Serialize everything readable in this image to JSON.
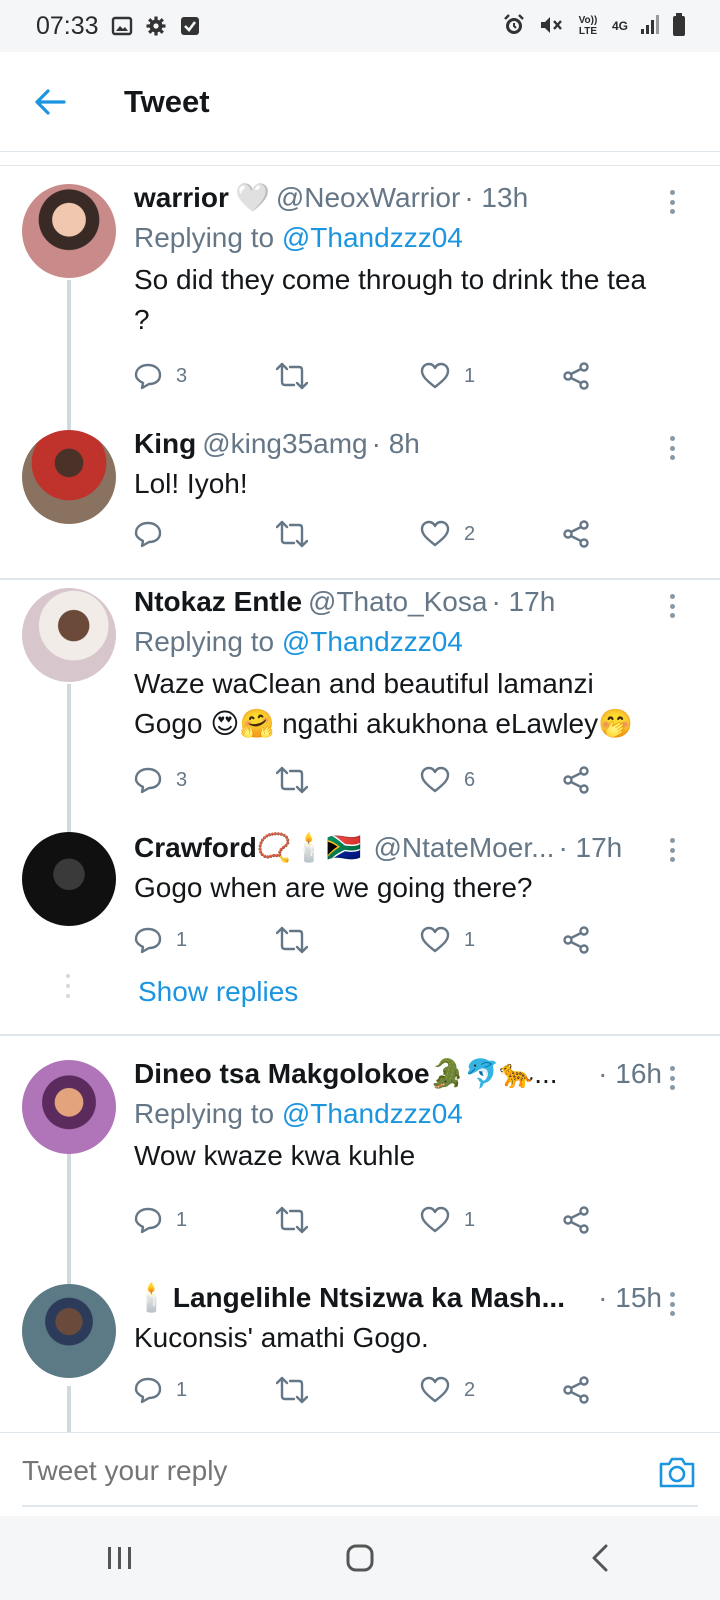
{
  "status_bar": {
    "time": "07:33",
    "network_lte": "Vo)) LTE",
    "network_gen": "4G"
  },
  "header": {
    "title": "Tweet"
  },
  "tweets": [
    {
      "name": "warrior",
      "emoji": "🤍",
      "handle": "@NeoxWarrior",
      "time": "· 13h",
      "replying_prefix": "Replying to ",
      "replying_to": "@Thandzzz04",
      "text": "So did they come through to drink the tea ?",
      "replies": "3",
      "retweets": "",
      "likes": "1",
      "avatar_color": "#c98a8a"
    },
    {
      "name": "King",
      "emoji": "",
      "handle": "@king35amg",
      "time": "· 8h",
      "replying_prefix": "",
      "replying_to": "",
      "text": "Lol!  Iyoh!",
      "replies": "",
      "retweets": "",
      "likes": "2",
      "avatar_color": "#7a5a48"
    },
    {
      "name": "Ntokaz Entle",
      "emoji": "",
      "handle": "@Thato_Kosa",
      "time": "· 17h",
      "replying_prefix": "Replying to ",
      "replying_to": "@Thandzzz04",
      "text": "Waze waClean and beautiful lamanzi Gogo 😍🤗 ngathi akukhona eLawley🤭",
      "replies": "3",
      "retweets": "",
      "likes": "6",
      "avatar_color": "#d7c6cc"
    },
    {
      "name": "Crawford",
      "emoji": "📿🕯️🇿🇦",
      "handle": "@NtateMoer...",
      "time": "· 17h",
      "replying_prefix": "",
      "replying_to": "",
      "text": "Gogo when are we going there?",
      "replies": "1",
      "retweets": "",
      "likes": "1",
      "avatar_color": "#101010"
    },
    {
      "name": "Dineo tsa Makgolokoe",
      "emoji": "🐊🐬🐆...",
      "handle": "",
      "time": "· 16h",
      "replying_prefix": "Replying to ",
      "replying_to": "@Thandzzz04",
      "text": "Wow kwaze kwa kuhle",
      "replies": "1",
      "retweets": "",
      "likes": "1",
      "avatar_color": "#b074b8"
    },
    {
      "name": "Langelihle Ntsizwa ka Mash...",
      "emoji": "",
      "prefix_emoji": "🕯️",
      "handle": "",
      "time": "· 15h",
      "replying_prefix": "",
      "replying_to": "",
      "text": "Kuconsis' amathi Gogo.",
      "replies": "1",
      "retweets": "",
      "likes": "2",
      "avatar_color": "#5b7a86"
    }
  ],
  "show_replies": "Show replies",
  "reply_bar": {
    "placeholder": "Tweet your reply"
  },
  "colors": {
    "accent": "#1b95e0",
    "text": "#14171a",
    "muted": "#657786",
    "divider": "#e1e8ed"
  },
  "icons": [
    "image-icon",
    "settings-icon",
    "checkbox-icon",
    "alarm-icon",
    "mute-icon",
    "signal-icon",
    "battery-icon",
    "back-arrow-icon",
    "reply-icon",
    "retweet-icon",
    "like-icon",
    "share-icon",
    "more-icon",
    "camera-icon",
    "recent-apps-icon",
    "home-icon",
    "nav-back-icon"
  ]
}
